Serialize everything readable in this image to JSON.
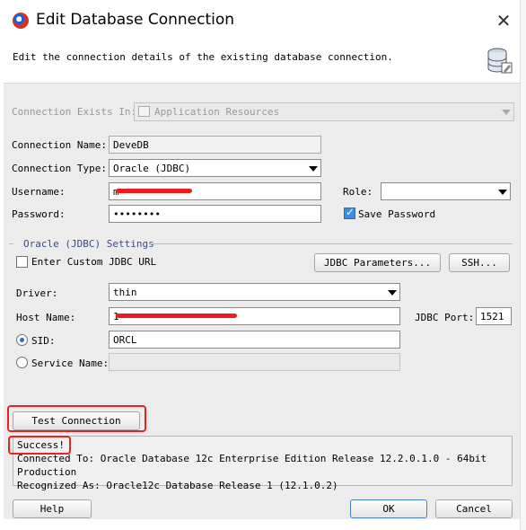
{
  "window": {
    "title": "Edit Database Connection"
  },
  "header": {
    "description": "Edit the connection details of the existing database connection."
  },
  "connection_exists_in": {
    "label": "Connection Exists In:",
    "value": "Application Resources"
  },
  "connection_name": {
    "label": "Connection Name:",
    "value": "DeveDB"
  },
  "connection_type": {
    "label": "Connection Type:",
    "value": "Oracle (JDBC)"
  },
  "username": {
    "label": "Username:",
    "value": "m"
  },
  "role": {
    "label": "Role:",
    "value": ""
  },
  "password": {
    "label": "Password:",
    "value": "••••••••"
  },
  "save_password": {
    "label": "Save Password",
    "checked": true
  },
  "oracle_settings": {
    "section_label": "Oracle (JDBC) Settings",
    "enter_custom_url": {
      "label": "Enter Custom JDBC URL",
      "checked": false
    },
    "jdbc_parameters_label": "JDBC Parameters...",
    "ssh_label": "SSH...",
    "driver": {
      "label": "Driver:",
      "value": "thin"
    },
    "host_name": {
      "label": "Host Name:",
      "value": "1"
    },
    "jdbc_port": {
      "label": "JDBC Port:",
      "value": "1521"
    },
    "sid": {
      "label": "SID:",
      "value": "ORCL",
      "selected": true
    },
    "service_name": {
      "label": "Service Name:",
      "value": "",
      "selected": false
    }
  },
  "test_connection_label": "Test Connection",
  "result": {
    "status": "Success!",
    "line1": "Connected To: Oracle Database 12c Enterprise Edition Release 12.2.0.1.0 - 64bit Production",
    "line2": "Recognized As: Oracle12c Database Release 1 (12.1.0.2)"
  },
  "footer": {
    "help_label": "Help",
    "ok_label": "OK",
    "cancel_label": "Cancel"
  },
  "colors": {
    "annotation": "#ef2020",
    "section": "#3a4a8a"
  }
}
